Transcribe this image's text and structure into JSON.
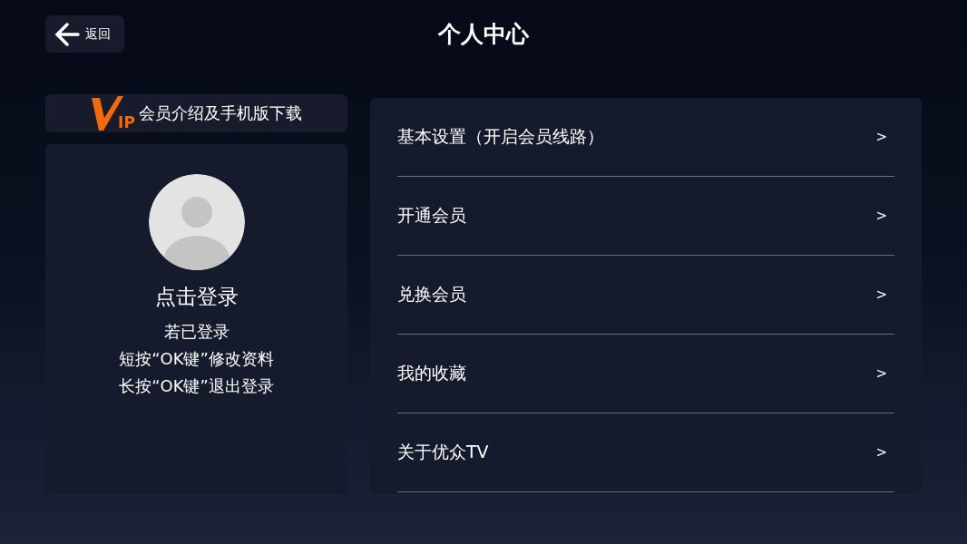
{
  "header": {
    "back_label": "返回",
    "title": "个人中心"
  },
  "vip_banner": {
    "logo_text": "IP",
    "label": "会员介绍及手机版下载"
  },
  "profile": {
    "login_label": "点击登录",
    "hints": [
      "若已登录",
      "短按“OK键”修改资料",
      "长按“OK键”退出登录"
    ]
  },
  "menu": [
    {
      "label": "基本设置（开启会员线路）",
      "arrow": ">"
    },
    {
      "label": "开通会员",
      "arrow": ">"
    },
    {
      "label": "兑换会员",
      "arrow": ">"
    },
    {
      "label": "我的收藏",
      "arrow": ">"
    },
    {
      "label": "关于优众TV",
      "arrow": ">"
    }
  ]
}
